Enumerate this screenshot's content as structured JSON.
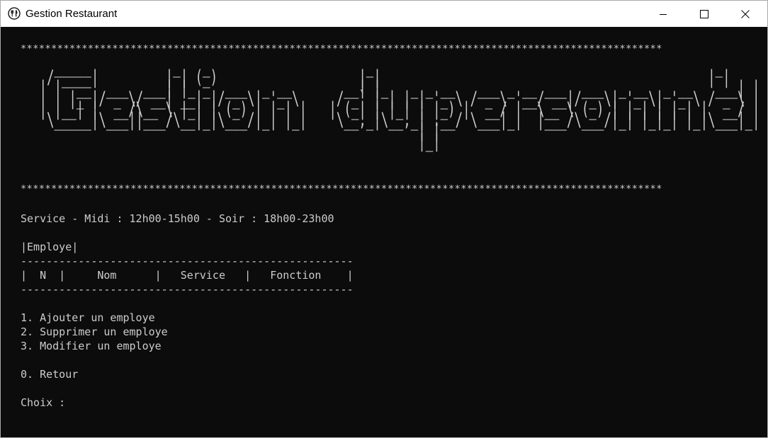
{
  "window": {
    "title": "Gestion Restaurant"
  },
  "icons": {
    "app": "fork-knife-icon",
    "minimize": "minimize-icon",
    "maximize": "maximize-icon",
    "close": "close-icon"
  },
  "console": {
    "stars_top": "*********************************************************************************************************",
    "banner": [
      "   _____           _   _                     _                                              _ ",
      "  / ____|         | | (_)                   | |                                            | |",
      " | |  __  ___  ___| |_ _  ___  _ __       __| |_   _ _ __   ___ _ __ ___  ___  _ __  _ __   ___| |",
      " | | |_ |/ _ \\/ __| __| |/ _ \\| '_ \\     / _` | | | | '_ \\ / _ \\ '__/ __|/ _ \\| '_ \\| '_ \\ / _ \\ |",
      " | |__| |  __/\\__ \\ |_| | (_) | | | |   | (_| | |_| | |_) |  __/ |  \\__ \\ (_) | | | | | | |  __/ |",
      "  \\_____|\\___||___/\\__|_|\\___/|_| |_|    \\__,_|\\__,_| .__/ \\___|_|  |___/\\___/|_| |_|_| |_|\\___|_|",
      "                                                    | |                                          ",
      "                                                    |_|                                          "
    ],
    "stars_bottom": "*********************************************************************************************************",
    "service_line": "Service - Midi : 12h00-15h00 - Soir : 18h00-23h00",
    "section_label": "|Employe|",
    "table_separator_top": "----------------------------------------------------",
    "table_header": "|  N  |     Nom      |   Service   |   Fonction    |",
    "table_separator_bottom": "----------------------------------------------------",
    "menu": [
      "1. Ajouter un employe",
      "2. Supprimer un employe",
      "3. Modifier un employe"
    ],
    "back_option": "0. Retour",
    "prompt": "Choix : "
  },
  "colors": {
    "console_background": "#0c0c0c",
    "console_text": "#cccccc",
    "titlebar_background": "#ffffff"
  }
}
